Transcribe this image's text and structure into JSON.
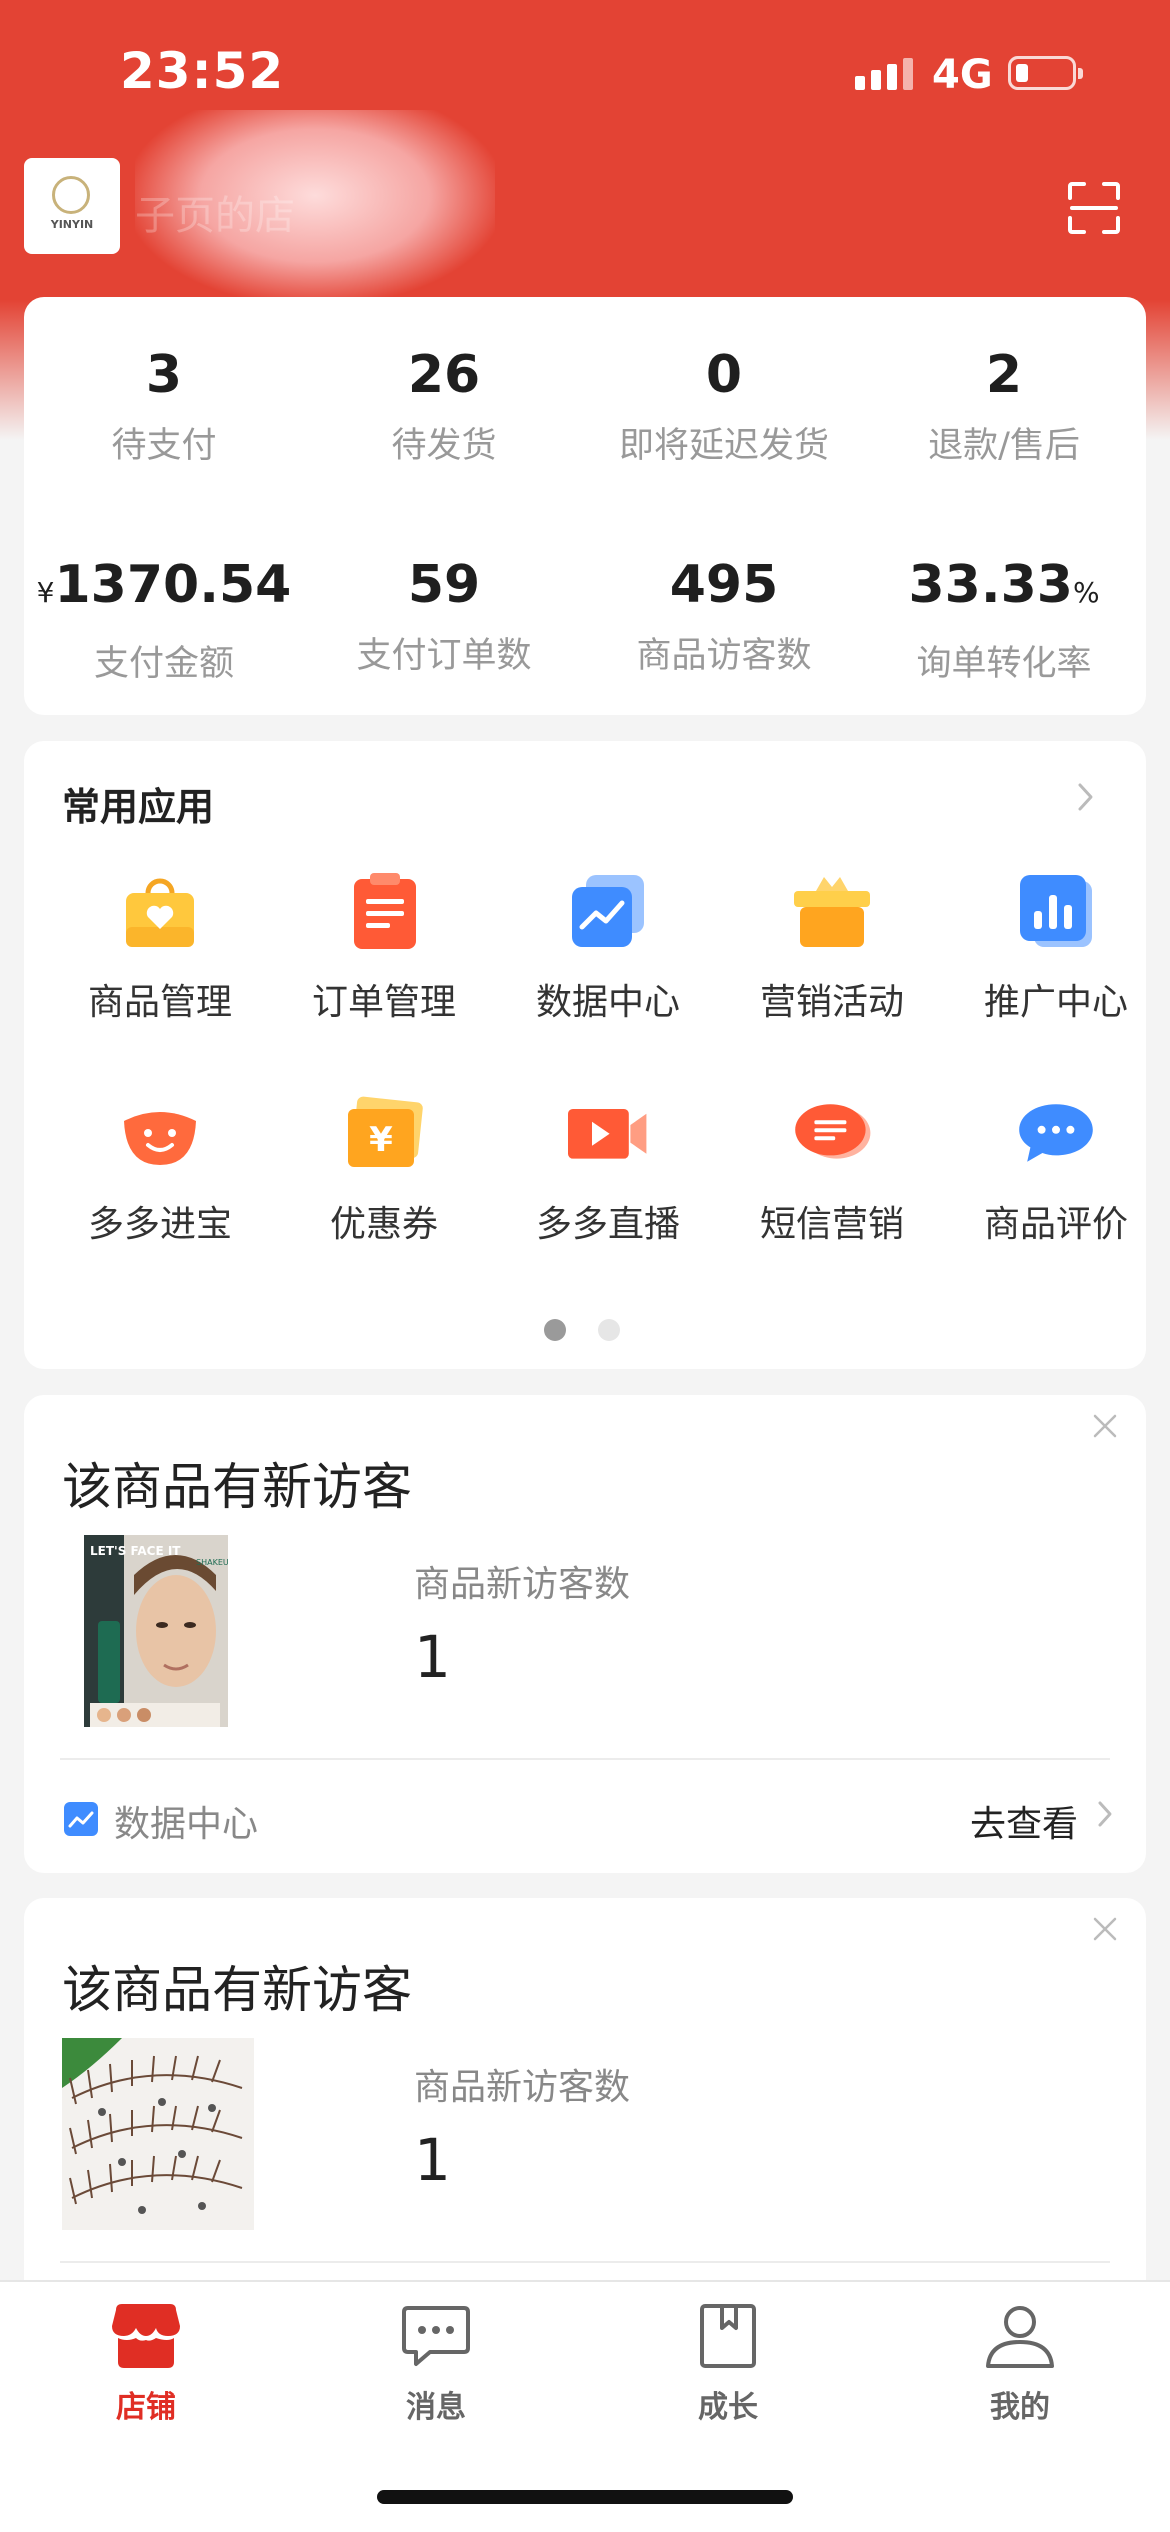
{
  "status_bar": {
    "time": "23:52",
    "network": "4G"
  },
  "store": {
    "name": "子页的店",
    "logo_text": "YINYIN"
  },
  "stats": {
    "row1": [
      {
        "value": "3",
        "label": "待支付"
      },
      {
        "value": "26",
        "label": "待发货"
      },
      {
        "value": "0",
        "label": "即将延迟发货"
      },
      {
        "value": "2",
        "label": "退款/售后"
      }
    ],
    "row2": [
      {
        "unit": "¥",
        "value": "1370.54",
        "label": "支付金额"
      },
      {
        "value": "59",
        "label": "支付订单数"
      },
      {
        "value": "495",
        "label": "商品访客数"
      },
      {
        "value": "33.33",
        "suffix": "%",
        "label": "询单转化率"
      }
    ]
  },
  "apps": {
    "title": "常用应用",
    "items": [
      {
        "label": "商品管理",
        "icon": "shopping-bag-icon"
      },
      {
        "label": "订单管理",
        "icon": "order-list-icon"
      },
      {
        "label": "数据中心",
        "icon": "data-chart-icon"
      },
      {
        "label": "营销活动",
        "icon": "gift-box-icon"
      },
      {
        "label": "推广中心",
        "icon": "bar-chart-icon"
      },
      {
        "label": "多多进宝",
        "icon": "ingot-icon"
      },
      {
        "label": "优惠券",
        "icon": "coupon-icon"
      },
      {
        "label": "多多直播",
        "icon": "video-camera-icon"
      },
      {
        "label": "短信营销",
        "icon": "sms-icon"
      },
      {
        "label": "商品评价",
        "icon": "chat-bubble-icon"
      }
    ],
    "page_count": 2,
    "current_page": 1
  },
  "visitor_cards": [
    {
      "title": "该商品有新访客",
      "metric_label": "商品新访客数",
      "metric_value": "1",
      "source": "数据中心",
      "action": "去查看",
      "thumb_text": "LET'S FACE IT",
      "thumb_brand": "SHAKEUP"
    },
    {
      "title": "该商品有新访客",
      "metric_label": "商品新访客数",
      "metric_value": "1"
    }
  ],
  "tabs": [
    {
      "label": "店铺",
      "icon": "store-icon",
      "active": true
    },
    {
      "label": "消息",
      "icon": "message-icon",
      "active": false
    },
    {
      "label": "成长",
      "icon": "book-icon",
      "active": false
    },
    {
      "label": "我的",
      "icon": "user-icon",
      "active": false
    }
  ],
  "colors": {
    "brand": "#e34334",
    "active_tab": "#e02e24"
  }
}
